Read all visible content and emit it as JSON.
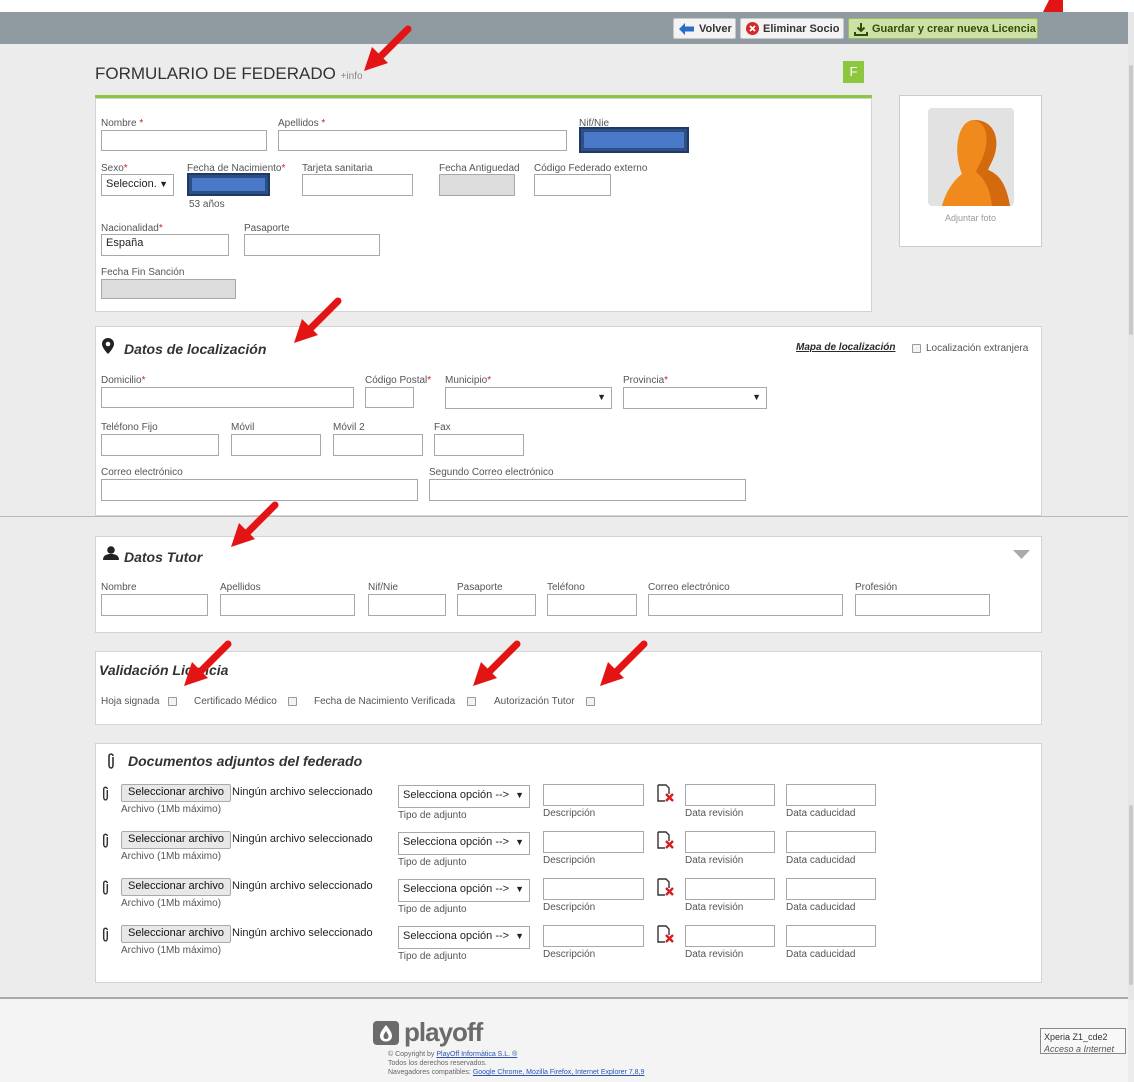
{
  "toolbar": {
    "back_label": "Volver",
    "delete_label": "Eliminar Socio",
    "save_label": "Guardar y crear nueva Licencia"
  },
  "form": {
    "title": "FORMULARIO DE FEDERADO",
    "info_link": "+info",
    "badge": "F",
    "fields": {
      "nombre": "Nombre",
      "apellidos": "Apellidos",
      "nif": "Nif/Nie",
      "sexo": "Sexo",
      "sexo_value": "Seleccion.",
      "fecha_nac": "Fecha de Nacimiento",
      "age": "53 años",
      "tarjeta": "Tarjeta sanitaria",
      "antiguedad": "Fecha Antiguedad",
      "codigo_ext": "Código Federado externo",
      "nacionalidad": "Nacionalidad",
      "nacionalidad_value": "España",
      "pasaporte": "Pasaporte",
      "fin_sancion": "Fecha Fin Sanción"
    },
    "required_mark": "*",
    "photo_label": "Adjuntar foto"
  },
  "localizacion": {
    "title": "Datos de localización",
    "map_link": "Mapa de localización",
    "foreign_label": "Localización extranjera",
    "fields": {
      "domicilio": "Domicilio",
      "cp": "Código Postal",
      "municipio": "Municipio",
      "provincia": "Provincia",
      "telefono": "Teléfono Fijo",
      "movil": "Móvil",
      "movil2": "Móvil 2",
      "fax": "Fax",
      "correo": "Correo electrónico",
      "correo2": "Segundo Correo electrónico"
    }
  },
  "tutor": {
    "title": "Datos Tutor",
    "fields": {
      "nombre": "Nombre",
      "apellidos": "Apellidos",
      "nif": "Nif/Nie",
      "pasaporte": "Pasaporte",
      "telefono": "Teléfono",
      "correo": "Correo electrónico",
      "profesion": "Profesión"
    }
  },
  "validacion": {
    "title": "Validación Licencia",
    "items": [
      "Hoja signada",
      "Certificado Médico",
      "Fecha de Nacimiento Verificada",
      "Autorización Tutor"
    ]
  },
  "documentos": {
    "title": "Documentos adjuntos del federado",
    "file_button": "Seleccionar archivo",
    "no_file": "Ningún archivo seleccionado",
    "max_note": "Archivo (1Mb máximo)",
    "select_value": "Selecciona opción -->",
    "tipo_label": "Tipo de adjunto",
    "desc_label": "Descripción",
    "revision_label": "Data revisión",
    "caducidad_label": "Data caducidad"
  },
  "footer": {
    "logo_text": "playoff",
    "copyright_prefix": "© Copyright by ",
    "copyright_link": "PlayOff Informàtica S.L. ®",
    "rights": "Todos los derechos reservados.",
    "browsers_prefix": "Navegadores compatibles: ",
    "browsers_links": "Google Chrome, Mozilla Firefox, Internet Explorer 7,8,9"
  },
  "tooltip": {
    "device": "Xperia Z1_cde2",
    "status": "Acceso a Internet"
  }
}
